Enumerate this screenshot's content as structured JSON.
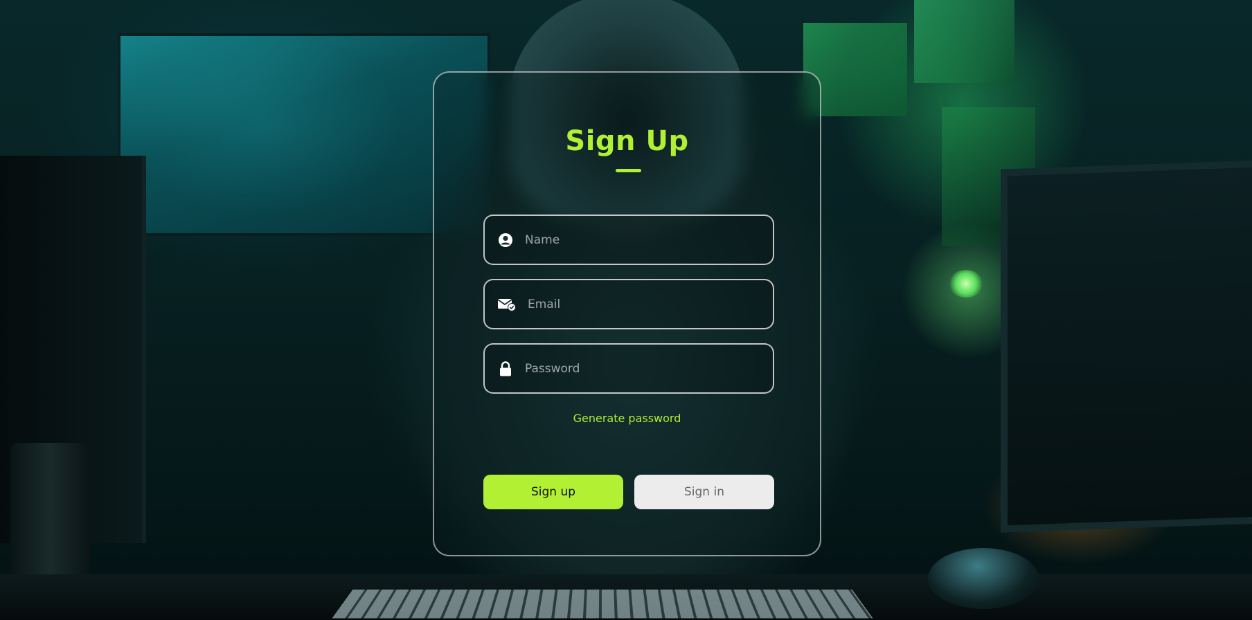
{
  "form": {
    "title": "Sign Up",
    "fields": {
      "name": {
        "placeholder": "Name",
        "value": "",
        "icon": "user-circle-icon"
      },
      "email": {
        "placeholder": "Email",
        "value": "",
        "icon": "envelope-check-icon"
      },
      "password": {
        "placeholder": "Password",
        "value": "",
        "icon": "lock-icon"
      }
    },
    "generate_password_label": "Generate password",
    "buttons": {
      "sign_up": "Sign up",
      "sign_in": "Sign in"
    }
  },
  "colors": {
    "accent": "#b1f033",
    "secondary_button": "#ececec",
    "secondary_button_text": "#666666",
    "field_border": "#ffffff"
  }
}
